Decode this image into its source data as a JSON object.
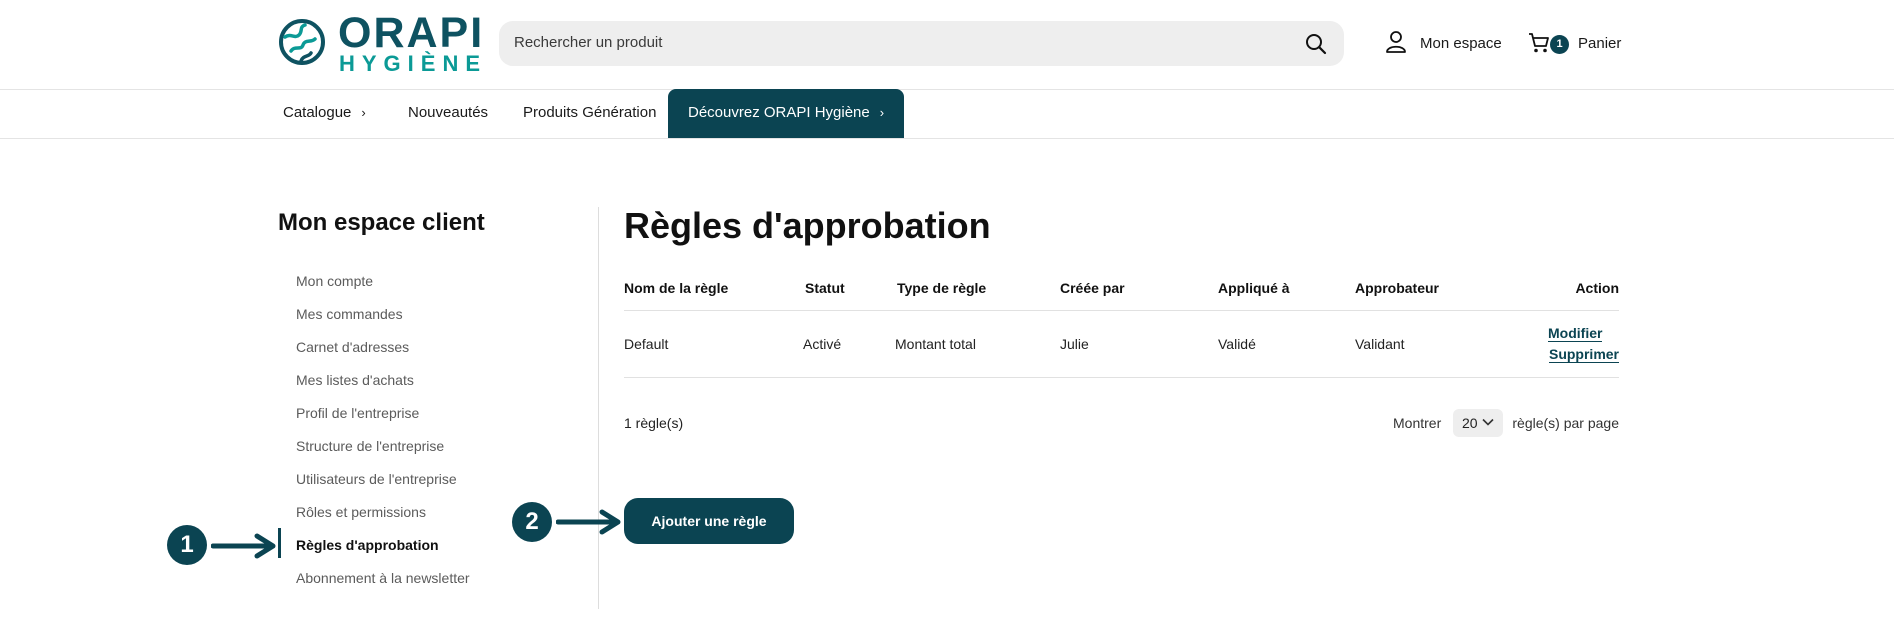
{
  "colors": {
    "brand_dark": "#0b4452",
    "brand_teal": "#0b9a96",
    "brand_logo_text": "#0e5261"
  },
  "header": {
    "logo_line1": "ORAPI",
    "logo_line2": "HYGIÈNE",
    "search_placeholder": "Rechercher un produit",
    "search_icon": "search-icon",
    "account_label": "Mon espace",
    "account_icon": "user-icon",
    "cart_label": "Panier",
    "cart_count": "1",
    "cart_icon": "cart-icon"
  },
  "nav": {
    "items": [
      {
        "label": "Catalogue",
        "chevron": "›"
      },
      {
        "label": "Nouveautés"
      },
      {
        "label": "Produits Génération"
      },
      {
        "label": "Découvrez ORAPI Hygiène",
        "chevron": "›"
      }
    ]
  },
  "sidebar": {
    "title": "Mon espace client",
    "items": [
      {
        "label": "Mon compte"
      },
      {
        "label": "Mes commandes"
      },
      {
        "label": "Carnet d'adresses"
      },
      {
        "label": "Mes listes d'achats"
      },
      {
        "label": "Profil de l'entreprise"
      },
      {
        "label": "Structure de l'entreprise"
      },
      {
        "label": "Utilisateurs de l'entreprise"
      },
      {
        "label": "Rôles et permissions"
      },
      {
        "label": "Règles d'approbation",
        "active": true
      },
      {
        "label": "Abonnement à la newsletter"
      }
    ]
  },
  "main": {
    "title": "Règles d'approbation",
    "table": {
      "headers": [
        "Nom de la règle",
        "Statut",
        "Type de règle",
        "Créée par",
        "Appliqué à",
        "Approbateur",
        "Action"
      ],
      "rows": [
        {
          "cells": [
            "Default",
            "Activé",
            "Montant total",
            "Julie",
            "Validé",
            "Validant"
          ],
          "actions": [
            "Modifier",
            "Supprimer"
          ]
        }
      ]
    },
    "count_text": "1 règle(s)",
    "pager": {
      "show_label": "Montrer",
      "per_page_value": "20",
      "per_page_suffix": "règle(s) par page"
    },
    "add_button": "Ajouter une règle"
  },
  "callouts": [
    "1",
    "2"
  ]
}
